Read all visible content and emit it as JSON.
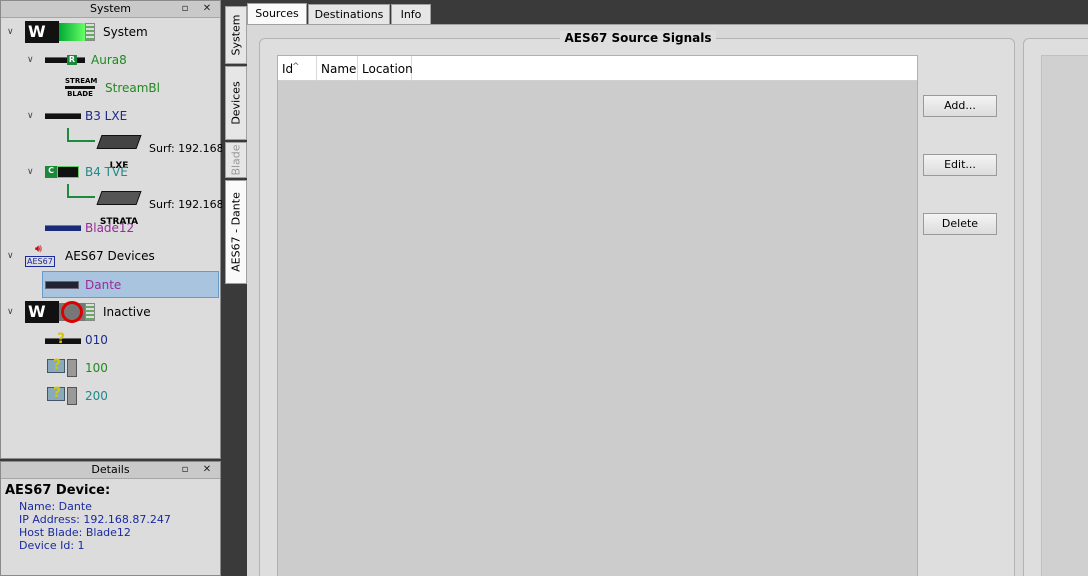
{
  "system_panel": {
    "title": "System",
    "pin": "▫",
    "close": "✕",
    "tree": {
      "system": "System",
      "aura8": "Aura8",
      "aura8_badge": "R",
      "streambl": "StreamBl",
      "streambl_logo": [
        "STREAM",
        "BLADE"
      ],
      "b3lxe": "B3 LXE",
      "lxe_logo": "LXE",
      "surf1": "Surf: 192.168.",
      "b4tve": "B4 TVE",
      "b4_badge": "C",
      "strata_logo": "STRATA",
      "surf2": "Surf: 192.168.",
      "blade12": "Blade12",
      "aes67_devices": "AES67 Devices",
      "aes67_logo": "AES67",
      "dante": "Dante",
      "inactive": "Inactive",
      "d010": "010",
      "d100": "100",
      "d200": "200"
    }
  },
  "details_panel": {
    "title": "Details",
    "heading": "AES67 Device:",
    "lines": [
      "Name: Dante",
      "IP Address: 192.168.87.247",
      "Host Blade: Blade12",
      "Device Id: 1"
    ]
  },
  "vertical_tabs": [
    "System",
    "Devices",
    "Blade",
    "AES67 - Dante"
  ],
  "top_tabs": [
    "Sources",
    "Destinations",
    "Info"
  ],
  "main": {
    "group_title": "AES67 Source Signals",
    "columns": [
      "Id",
      "Name",
      "Location"
    ],
    "buttons": {
      "add": "Add...",
      "edit": "Edit...",
      "delete": "Delete"
    }
  },
  "colors": {
    "green": "#1e8a1e",
    "darkblue": "#1c2b8a",
    "teal": "#1e8a8a",
    "purple": "#9a2a9a",
    "selection": "#a8c4de"
  }
}
